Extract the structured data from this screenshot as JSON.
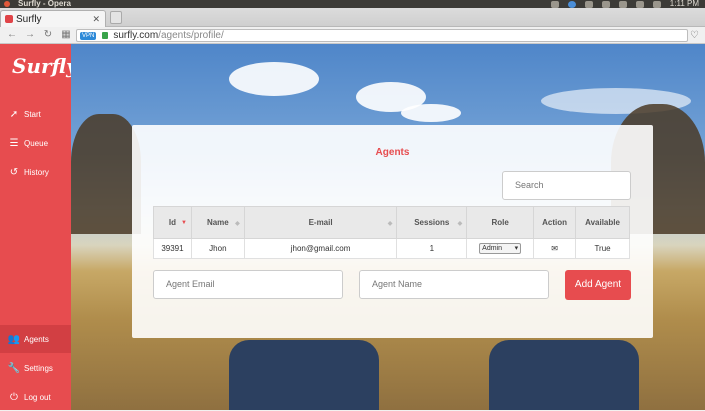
{
  "os": {
    "title": "Surfly - Opera",
    "clock": "1:11 PM"
  },
  "browser": {
    "tab_title": "Surfly",
    "vpn_label": "VPN",
    "url_domain": "surfly.com",
    "url_path": "/agents/profile/"
  },
  "sidebar": {
    "logo": "Surfly",
    "items": [
      {
        "label": "Start",
        "icon": "cursor-icon"
      },
      {
        "label": "Queue",
        "icon": "list-icon"
      },
      {
        "label": "History",
        "icon": "history-icon"
      },
      {
        "label": "Agents",
        "icon": "users-icon"
      },
      {
        "label": "Settings",
        "icon": "wrench-icon"
      },
      {
        "label": "Log out",
        "icon": "logout-icon"
      }
    ]
  },
  "card": {
    "title": "Agents",
    "search_placeholder": "Search",
    "columns": [
      "Id",
      "Name",
      "E-mail",
      "Sessions",
      "Role",
      "Action",
      "Available"
    ],
    "rows": [
      {
        "id": "39391",
        "name": "Jhon",
        "email": "jhon@gmail.com",
        "sessions": "1",
        "role": "Admin",
        "action": "mail-icon",
        "available": "True"
      }
    ],
    "agent_email_placeholder": "Agent Email",
    "agent_name_placeholder": "Agent Name",
    "add_label": "Add Agent"
  },
  "colors": {
    "accent": "#e74c4f"
  }
}
